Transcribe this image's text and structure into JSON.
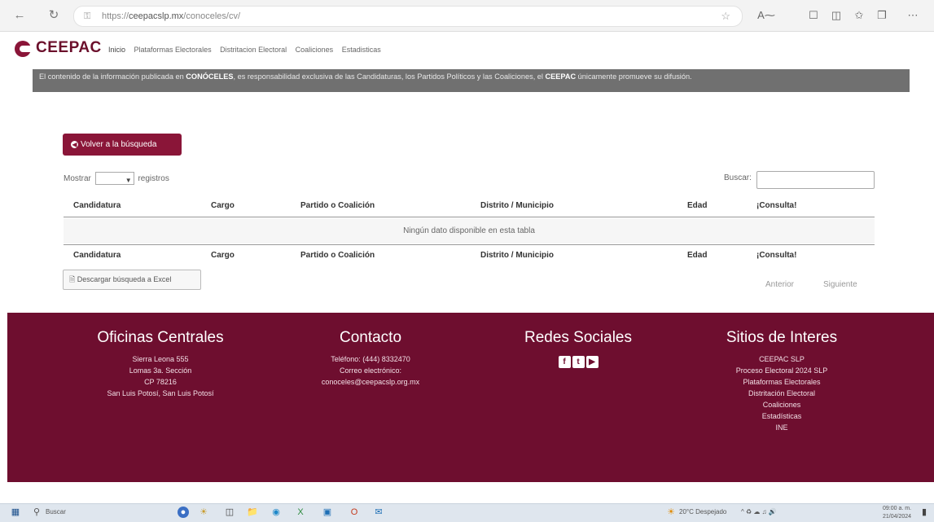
{
  "browser": {
    "url_prefix": "https://",
    "url_domain": "ceepacslp.mx",
    "url_path": "/conoceles/cv/"
  },
  "site": {
    "logo": "CEEPAC",
    "menu": [
      "Inicio",
      "Plataformas Electorales",
      "Distritacion Electoral",
      "Coaliciones",
      "Estadisticas"
    ]
  },
  "banner": {
    "part1": "El contenido de la información publicada en ",
    "bold1": "CONÓCELES",
    "part2": ", es responsabilidad exclusiva de las Candidaturas, los Partidos Políticos y las Coaliciones, el ",
    "bold2": "CEEPAC",
    "part3": " únicamente promueve su difusión."
  },
  "back_button": "Volver a la búsqueda",
  "table": {
    "show_label": "Mostrar",
    "records_label": "registros",
    "search_label": "Buscar:",
    "columns": [
      "Candidatura",
      "Cargo",
      "Partido o Coalición",
      "Distrito / Municipio",
      "Edad",
      "¡Consulta!"
    ],
    "empty_message": "Ningún dato disponible en esta tabla",
    "excel_button": "Descargar búsqueda a Excel",
    "prev": "Anterior",
    "next": "Siguiente"
  },
  "footer": {
    "offices": {
      "title": "Oficinas Centrales",
      "lines": [
        "Sierra Leona 555",
        "Lomas 3a. Sección",
        "CP 78216",
        "San Luis Potosí, San Luis Potosí"
      ]
    },
    "contact": {
      "title": "Contacto",
      "lines": [
        "Teléfono: (444) 8332470",
        "Correo electrónico:",
        "conoceles@ceepacslp.org.mx"
      ]
    },
    "social": {
      "title": "Redes Sociales",
      "icons": [
        "facebook-icon",
        "twitter-icon",
        "youtube-icon"
      ]
    },
    "sites": {
      "title": "Sitios de Interes",
      "lines": [
        "CEEPAC SLP",
        "Proceso Electoral 2024 SLP",
        "Plataformas Electorales",
        "Distritación Electoral",
        "Coaliciones",
        "Estadísticas",
        "INE"
      ]
    }
  },
  "taskbar": {
    "search_placeholder": "Buscar",
    "weather": "20°C Despejado",
    "time": "09:00 a. m.",
    "date": "21/04/2024"
  },
  "colors": {
    "brand": "#8a1538",
    "footer_bg": "#6e0e2f",
    "banner_bg": "#707070"
  }
}
